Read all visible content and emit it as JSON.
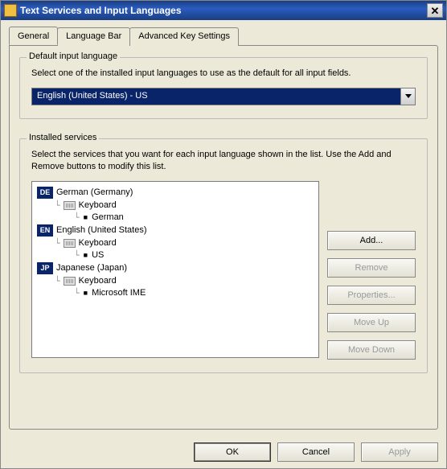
{
  "window": {
    "title": "Text Services and Input Languages"
  },
  "tabs": {
    "general": "General",
    "languageBar": "Language Bar",
    "advancedKey": "Advanced Key Settings"
  },
  "defaultLang": {
    "groupLabel": "Default input language",
    "description": "Select one of the installed input languages to use as the default for all input fields.",
    "selected": "English (United States) - US"
  },
  "installed": {
    "groupLabel": "Installed services",
    "description": "Select the services that you want for each input language shown in the list. Use the Add and Remove buttons to modify this list.",
    "categoryLabel": "Keyboard",
    "items": [
      {
        "code": "DE",
        "name": "German (Germany)",
        "layout": "German"
      },
      {
        "code": "EN",
        "name": "English (United States)",
        "layout": "US"
      },
      {
        "code": "JP",
        "name": "Japanese (Japan)",
        "layout": "Microsoft IME"
      }
    ]
  },
  "buttons": {
    "add": "Add...",
    "remove": "Remove",
    "properties": "Properties...",
    "moveUp": "Move Up",
    "moveDown": "Move Down",
    "ok": "OK",
    "cancel": "Cancel",
    "apply": "Apply"
  }
}
